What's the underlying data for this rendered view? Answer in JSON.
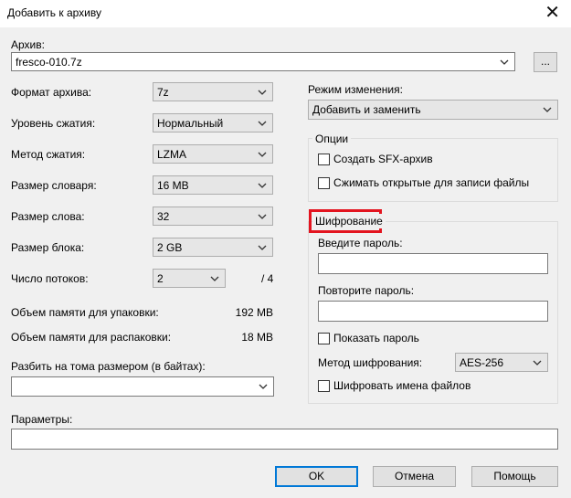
{
  "window": {
    "title": "Добавить к архиву",
    "close_glyph": "✕"
  },
  "archive": {
    "label": "Архив:",
    "value": "fresco-010.7z",
    "browse_label": "..."
  },
  "left": {
    "format": {
      "label": "Формат архива:",
      "value": "7z"
    },
    "level": {
      "label": "Уровень сжатия:",
      "value": "Нормальный"
    },
    "method": {
      "label": "Метод сжатия:",
      "value": "LZMA"
    },
    "dict": {
      "label": "Размер словаря:",
      "value": "16 MB"
    },
    "word": {
      "label": "Размер слова:",
      "value": "32"
    },
    "block": {
      "label": "Размер блока:",
      "value": "2 GB"
    },
    "threads": {
      "label": "Число потоков:",
      "value": "2",
      "max": "/ 4"
    },
    "mem_pack": {
      "label": "Объем памяти для упаковки:",
      "value": "192 MB"
    },
    "mem_unpack": {
      "label": "Объем памяти для распаковки:",
      "value": "18 MB"
    },
    "split": {
      "label": "Разбить на тома размером (в байтах):",
      "value": ""
    }
  },
  "right": {
    "mode": {
      "label": "Режим изменения:",
      "value": "Добавить и заменить"
    },
    "options": {
      "caption": "Опции",
      "sfx_label": "Создать SFX-архив",
      "sfx_checked": false,
      "shared_label": "Сжимать открытые для записи файлы",
      "shared_checked": false
    },
    "encryption": {
      "caption": "Шифрование",
      "password_label": "Введите пароль:",
      "password_value": "",
      "repeat_label": "Повторите пароль:",
      "repeat_value": "",
      "show_label": "Показать пароль",
      "show_checked": false,
      "method_label": "Метод шифрования:",
      "method_value": "AES-256",
      "names_label": "Шифровать имена файлов",
      "names_checked": false
    }
  },
  "params": {
    "label": "Параметры:",
    "value": ""
  },
  "buttons": {
    "ok": "OK",
    "cancel": "Отмена",
    "help": "Помощь"
  },
  "colors": {
    "highlight": "#e3141f",
    "focus": "#0078d7",
    "dialog_bg": "#f0f0f0"
  },
  "icons": {
    "dropdown": "chevron-down-icon",
    "close": "close-icon"
  }
}
